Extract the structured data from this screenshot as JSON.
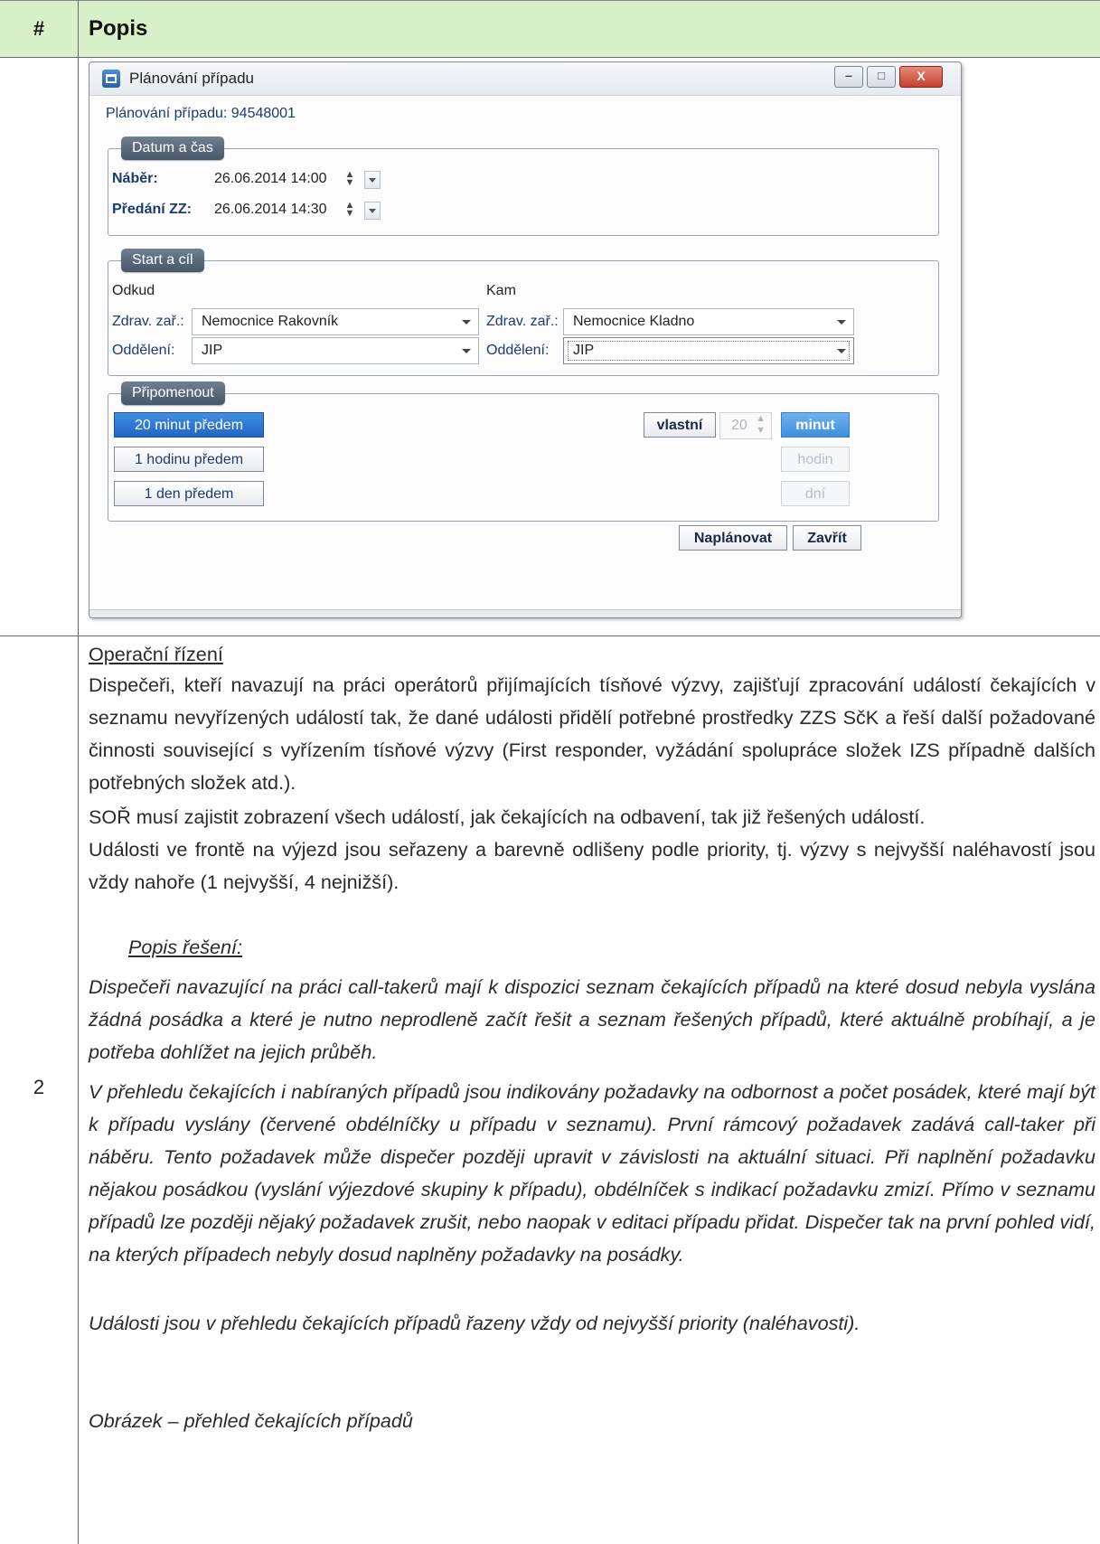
{
  "table": {
    "col_num_header": "#",
    "col_desc_header": "Popis",
    "row_number": "2"
  },
  "dialog": {
    "title": "Plánování případu",
    "subtitle": "Plánování případu: 94548001",
    "window_buttons": {
      "minimize": "‒",
      "maximize": "□",
      "close": "X"
    },
    "datum_group": {
      "legend": "Datum a čas",
      "naber_label": "Náběr:",
      "naber_value": "26.06.2014 14:00",
      "predani_label": "Předání ZZ:",
      "predani_value": "26.06.2014 14:30"
    },
    "start_group": {
      "legend": "Start a cíl",
      "odkud": "Odkud",
      "kam": "Kam",
      "zdrav_label": "Zdrav. zař.:",
      "oddeleni_label": "Oddělení:",
      "odkud_zdrav_value": "Nemocnice Rakovník",
      "odkud_oddeleni_value": "JIP",
      "kam_zdrav_value": "Nemocnice Kladno",
      "kam_oddeleni_value": "JIP"
    },
    "pripomenout_group": {
      "legend": "Připomenout",
      "opt1": "20 minut předem",
      "opt2": "1 hodinu předem",
      "opt3": "1 den předem",
      "vlastni": "vlastní",
      "number_value": "20",
      "unit_minut": "minut",
      "unit_hodin": "hodin",
      "unit_dni": "dní"
    },
    "btn_naplanovat": "Naplánovat",
    "btn_zavrit": "Zavřít"
  },
  "content": {
    "heading": "Operační řízení",
    "para1": "Dispečeři, kteří navazují na práci operátorů přijímajících tísňové výzvy, zajišťují zpracování událostí čekajících v seznamu nevyřízených událostí tak, že dané události přidělí potřebné prostředky ZZS SčK a řeší další požadované činnosti související s vyřízením tísňové výzvy (First responder, vyžádání spolupráce složek IZS případně dalších potřebných složek atd.).",
    "para2": "SOŘ musí zajistit zobrazení všech událostí, jak čekajících na odbavení, tak již řešených událostí.",
    "para3": "Události ve frontě na výjezd jsou seřazeny a barevně odlišeny podle priority, tj. výzvy s nejvyšší naléhavostí jsou vždy nahoře (1 nejvyšší, 4 nejnižší).",
    "subheading": "Popis řešení:",
    "para4": "Dispečeři navazující na práci call-takerů mají k dispozici seznam čekajících případů na které dosud nebyla vyslána žádná posádka a které je nutno neprodleně začít řešit a seznam řešených případů, které aktuálně probíhají, a je potřeba dohlížet na jejich průběh.",
    "para5": "V přehledu čekajících i nabíraných případů jsou indikovány požadavky na odbornost a počet posádek, které mají být k případu vyslány (červené obdélníčky u případu v seznamu). První rámcový požadavek zadává call-taker při náběru. Tento požadavek může dispečer později upravit v závislosti na aktuální situaci. Při naplnění požadavku nějakou posádkou (vyslání výjezdové skupiny k případu), obdélníček s indikací požadavku zmizí. Přímo v seznamu případů lze později nějaký požadavek zrušit, nebo naopak v editaci případu přidat. Dispečer tak na první pohled vidí, na kterých případech nebyly dosud naplněny požadavky na posádky.",
    "para6": "Události jsou v přehledu čekajících případů řazeny vždy od nejvyšší priority (naléhavosti).",
    "caption": "Obrázek – přehled čekajících případů"
  }
}
